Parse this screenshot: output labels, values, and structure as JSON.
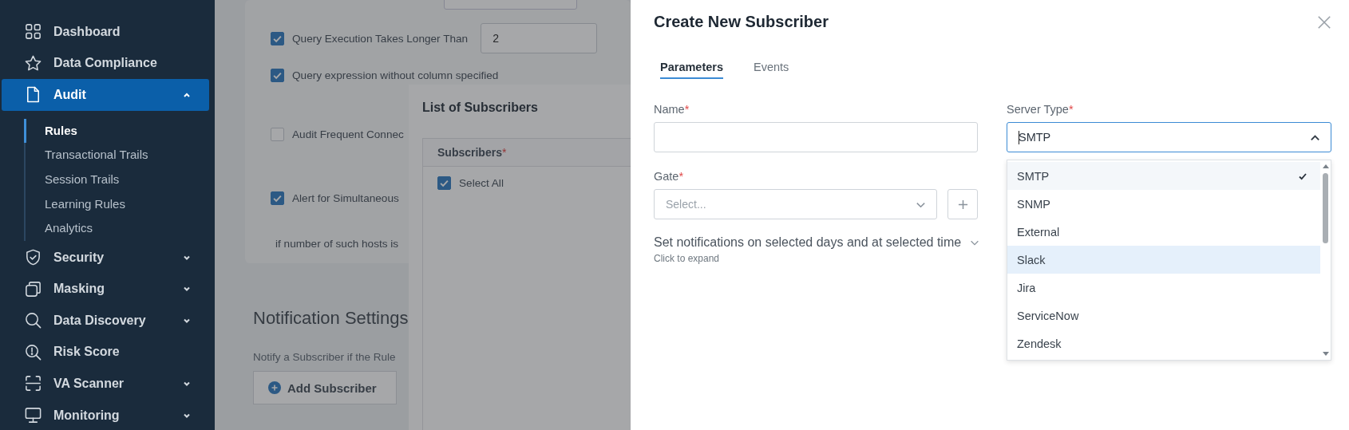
{
  "sidebar": {
    "items": [
      {
        "label": "Dashboard",
        "selected": false
      },
      {
        "label": "Data Compliance",
        "selected": false
      },
      {
        "label": "Audit",
        "selected": true,
        "expanded": true,
        "children": [
          {
            "label": "Rules",
            "selected": true
          },
          {
            "label": "Transactional Trails",
            "selected": false
          },
          {
            "label": "Session Trails",
            "selected": false
          },
          {
            "label": "Learning Rules",
            "selected": false
          },
          {
            "label": "Analytics",
            "selected": false
          }
        ]
      },
      {
        "label": "Security",
        "selected": false,
        "expanded": false
      },
      {
        "label": "Masking",
        "selected": false,
        "expanded": false
      },
      {
        "label": "Data Discovery",
        "selected": false,
        "expanded": false
      },
      {
        "label": "Risk Score",
        "selected": false
      },
      {
        "label": "VA Scanner",
        "selected": false,
        "expanded": false
      },
      {
        "label": "Monitoring",
        "selected": false,
        "expanded": false
      }
    ]
  },
  "rule_settings": {
    "rows": [
      {
        "kind": "input",
        "label": "Query Execution Takes Longer Than",
        "checked": true,
        "value": "2"
      },
      {
        "kind": "plain",
        "label": "Query expression without column specified",
        "checked": true
      },
      {
        "kind": "plain",
        "label": "Audit Frequent Connec",
        "checked": false
      },
      {
        "kind": "plain",
        "label": "Alert for Simultaneous",
        "checked": true
      }
    ],
    "note": "if number of such hosts is"
  },
  "notification_settings": {
    "title": "Notification Settings",
    "description": "Notify a Subscriber if the Rule",
    "add_button": "Add Subscriber"
  },
  "subscribers_panel": {
    "title": "List of Subscribers",
    "column": "Subscribers",
    "required_mark": "*",
    "select_all": {
      "label": "Select All",
      "checked": true
    }
  },
  "drawer": {
    "title": "Create New Subscriber",
    "tabs": [
      {
        "label": "Parameters",
        "selected": true
      },
      {
        "label": "Events",
        "selected": false
      }
    ],
    "name_field": {
      "label": "Name",
      "required_mark": "*"
    },
    "server_type": {
      "label": "Server Type",
      "required_mark": "*",
      "value": "SMTP",
      "expanded": true,
      "options": [
        {
          "label": "SMTP",
          "selected": true,
          "highlighted": false
        },
        {
          "label": "SNMP",
          "selected": false,
          "highlighted": false
        },
        {
          "label": "External",
          "selected": false,
          "highlighted": false
        },
        {
          "label": "Slack",
          "selected": false,
          "highlighted": true
        },
        {
          "label": "Jira",
          "selected": false,
          "highlighted": false
        },
        {
          "label": "ServiceNow",
          "selected": false,
          "highlighted": false
        },
        {
          "label": "Zendesk",
          "selected": false,
          "highlighted": false
        }
      ]
    },
    "gate": {
      "label": "Gate",
      "required_mark": "*",
      "placeholder": "Select..."
    },
    "schedule": {
      "title": "Set notifications on selected days and at selected time",
      "hint": "Click to expand",
      "expanded": false
    }
  }
}
